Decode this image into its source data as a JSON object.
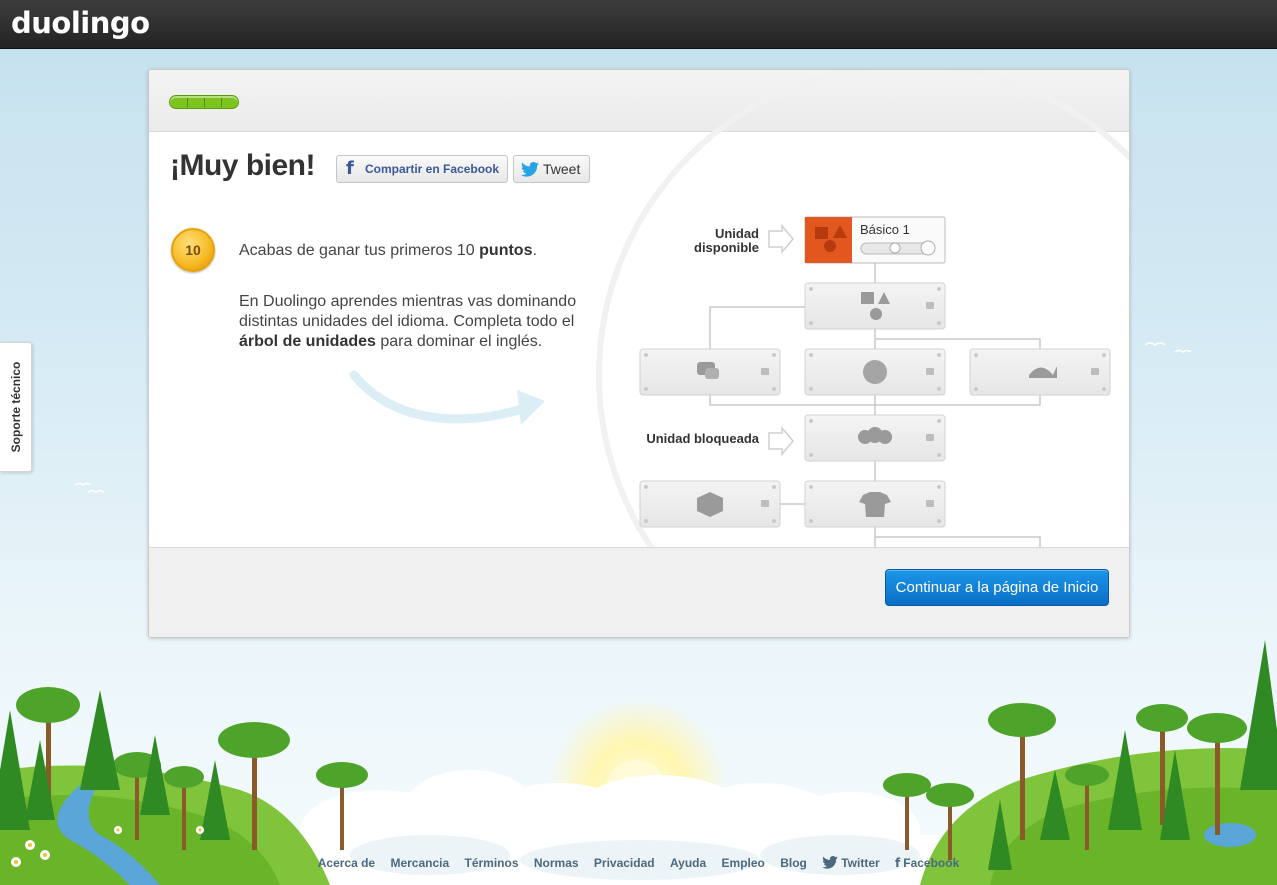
{
  "header": {
    "logo": "duolingo"
  },
  "support_tab": {
    "label": "Soporte técnico"
  },
  "lesson": {
    "progress_percent": 100
  },
  "title": "¡Muy bien!",
  "share": {
    "facebook_label": "Compartir en Facebook",
    "tweet_label": "Tweet"
  },
  "medal": {
    "points": "10"
  },
  "message": {
    "line1_pre": "Acabas de ganar tus primeros 10 ",
    "line1_bold": "puntos",
    "line1_post": ".",
    "line2_pre": "En Duolingo aprendes mientras vas dominando distintas unidades del idioma. Completa todo el ",
    "line2_bold": "árbol de unidades",
    "line2_post": " para dominar el inglés."
  },
  "tree": {
    "available_label": "Unidad disponible",
    "locked_label": "Unidad bloqueada",
    "first_unit": "Básico 1"
  },
  "continue_button": "Continuar a la página de Inicio",
  "footer": {
    "links": [
      "Acerca de",
      "Mercancia",
      "Términos",
      "Normas",
      "Privacidad",
      "Ayuda",
      "Empleo",
      "Blog"
    ],
    "twitter": "Twitter",
    "facebook": "Facebook"
  },
  "colors": {
    "accent_blue": "#0a6ec6",
    "progress_green": "#7ec41f",
    "unit_orange": "#e2571f"
  }
}
